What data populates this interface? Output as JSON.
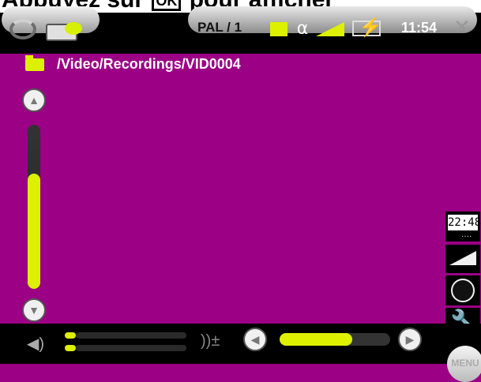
{
  "headline": {
    "prefix": "Appuyez sur",
    "key": "OK",
    "suffix": "pour afficher"
  },
  "statusbar": {
    "mode_label": "PAL / 1",
    "clock": "11:54",
    "close_glyph": "✕"
  },
  "browser": {
    "path": "/Video/Recordings/VID0004"
  },
  "volume_slider": {
    "level_fraction": 0.7
  },
  "side_panel": {
    "clock_display": "22:48",
    "clock_dots": "····"
  },
  "bottombar": {
    "speaker_glyph": "◀)",
    "volume_plusminus": "))±",
    "progress_fraction": 0.66,
    "menu_label": "MENU"
  },
  "colors": {
    "background": "#9b0085",
    "accent": "#ddf000"
  },
  "icons": [
    "cycle-icon",
    "memory-card-icon",
    "square-icon",
    "headphone-icon",
    "signal-icon",
    "battery-charging-icon",
    "close-icon",
    "folder-icon",
    "arrow-up-icon",
    "arrow-down-icon",
    "clock-icon",
    "wedge-icon",
    "record-icon",
    "wrench-icon",
    "speaker-icon",
    "arrow-left-icon",
    "arrow-right-icon"
  ]
}
